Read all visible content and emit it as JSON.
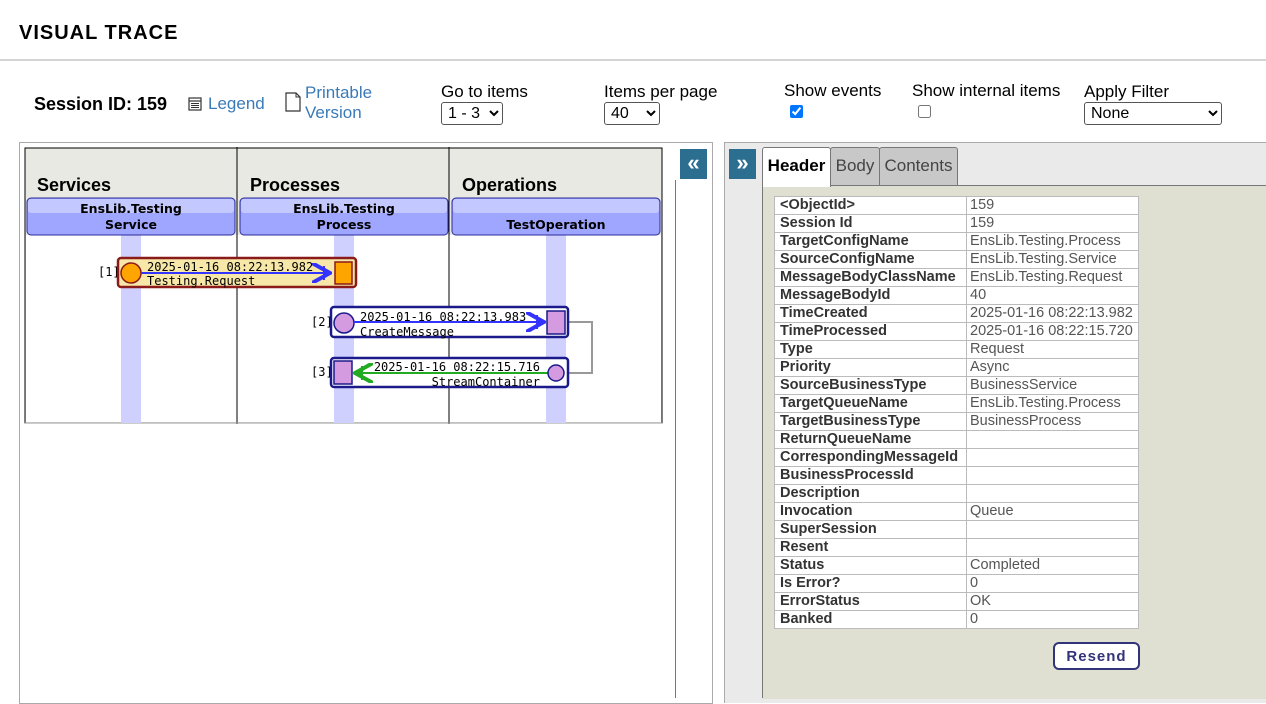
{
  "page": {
    "title": "VISUAL TRACE"
  },
  "toolbar": {
    "session_label": "Session ID: 159",
    "legend_label": "Legend",
    "printable_line1": "Printable",
    "printable_line2": "Version",
    "goto_label": "Go to items",
    "goto_value": "1 - 3",
    "perpage_label": "Items per page",
    "perpage_value": "40",
    "show_events_label": "Show events",
    "show_events_checked": true,
    "show_internal_label": "Show internal items",
    "show_internal_checked": false,
    "filter_label": "Apply Filter",
    "filter_value": "None"
  },
  "diagram": {
    "columns": [
      {
        "title": "Services",
        "box_line1": "EnsLib.Testing",
        "box_line2": "Service"
      },
      {
        "title": "Processes",
        "box_line1": "EnsLib.Testing",
        "box_line2": "Process"
      },
      {
        "title": "Operations",
        "box_line1": "",
        "box_line2": "TestOperation"
      }
    ],
    "messages": [
      {
        "index": "[1]",
        "time": "2025-01-16 08:22:13.982",
        "name": "Testing.Request"
      },
      {
        "index": "[2]",
        "time": "2025-01-16 08:22:13.983",
        "name": "CreateMessage"
      },
      {
        "index": "[3]",
        "time": "2025-01-16 08:22:15.716",
        "name": "StreamContainer"
      }
    ],
    "collapse_icon": "«",
    "expand_icon": "»"
  },
  "tabs": [
    "Header",
    "Body",
    "Contents"
  ],
  "header_rows": [
    {
      "key": "<ObjectId>",
      "value": "159"
    },
    {
      "key": "Session Id",
      "value": "159"
    },
    {
      "key": "TargetConfigName",
      "value": "EnsLib.Testing.Process"
    },
    {
      "key": "SourceConfigName",
      "value": "EnsLib.Testing.Service"
    },
    {
      "key": "MessageBodyClassName",
      "value": "EnsLib.Testing.Request"
    },
    {
      "key": "MessageBodyId",
      "value": "40"
    },
    {
      "key": "TimeCreated",
      "value": "2025-01-16 08:22:13.982"
    },
    {
      "key": "TimeProcessed",
      "value": "2025-01-16 08:22:15.720"
    },
    {
      "key": "Type",
      "value": "Request"
    },
    {
      "key": "Priority",
      "value": "Async"
    },
    {
      "key": "SourceBusinessType",
      "value": "BusinessService"
    },
    {
      "key": "TargetQueueName",
      "value": "EnsLib.Testing.Process"
    },
    {
      "key": "TargetBusinessType",
      "value": "BusinessProcess"
    },
    {
      "key": "ReturnQueueName",
      "value": ""
    },
    {
      "key": "CorrespondingMessageId",
      "value": ""
    },
    {
      "key": "BusinessProcessId",
      "value": ""
    },
    {
      "key": "Description",
      "value": ""
    },
    {
      "key": "Invocation",
      "value": "Queue"
    },
    {
      "key": "SuperSession",
      "value": ""
    },
    {
      "key": "Resent",
      "value": ""
    },
    {
      "key": "Status",
      "value": "Completed"
    },
    {
      "key": "Is Error?",
      "value": "0"
    },
    {
      "key": "ErrorStatus",
      "value": "OK"
    },
    {
      "key": "Banked",
      "value": "0"
    }
  ],
  "resend_label": "Resend",
  "colors": {
    "lifeline": "#d0d0ff",
    "column_bg": "#e9e9e4",
    "box_fill": "#9ea6ff",
    "msg1_fill": "#f7e7a8",
    "msg1_border": "#8b1a1a",
    "msg_border": "#1a1a8a",
    "orange": "#ffa500",
    "pink": "#d59be0",
    "arrow_blue": "#3333ff",
    "arrow_green": "#22aa22",
    "accent": "#2c6e8f"
  }
}
